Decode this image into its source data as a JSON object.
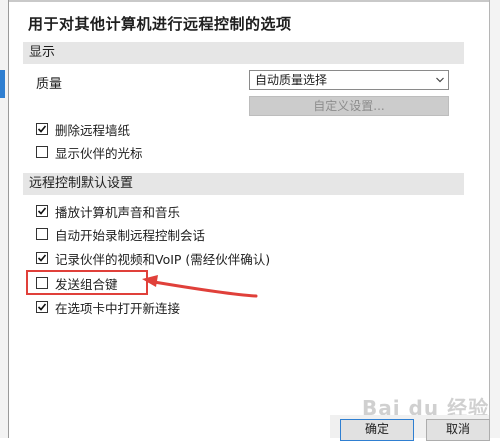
{
  "panel_title": "用于对其他计算机进行远程控制的选项",
  "sections": {
    "display": {
      "header": "显示",
      "quality_label": "质量",
      "quality_value": "自动质量选择",
      "custom_settings_button": "自定义设置...",
      "checkboxes": [
        {
          "label": "删除远程墙纸",
          "checked": true
        },
        {
          "label": "显示伙伴的光标",
          "checked": false
        }
      ]
    },
    "defaults": {
      "header": "远程控制默认设置",
      "checkboxes": [
        {
          "label": "播放计算机声音和音乐",
          "checked": true
        },
        {
          "label": "自动开始录制远程控制会话",
          "checked": false
        },
        {
          "label": "记录伙伴的视频和VoIP (需经伙伴确认)",
          "checked": true
        },
        {
          "label": "发送组合键",
          "checked": false
        },
        {
          "label": "在选项卡中打开新连接",
          "checked": true
        }
      ]
    }
  },
  "buttons": {
    "ok": "确定",
    "cancel": "取消"
  },
  "watermark": "Bai du 经验",
  "colors": {
    "accent": "#2f7fd1",
    "annotation": "#e0403a"
  }
}
